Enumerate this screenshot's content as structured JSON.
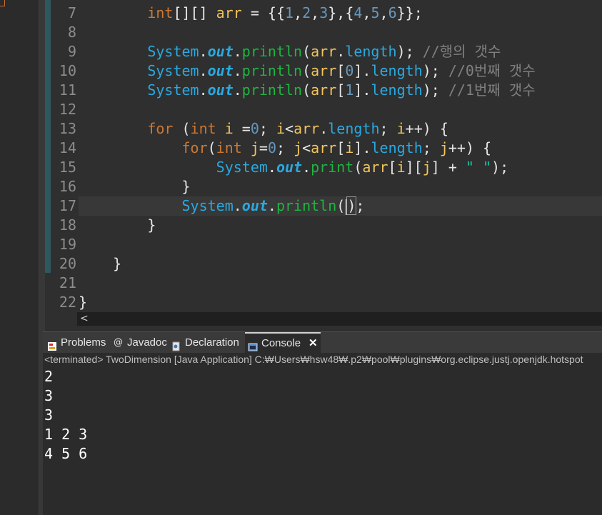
{
  "editor": {
    "line_numbers": [
      "7",
      "8",
      "9",
      "10",
      "11",
      "12",
      "13",
      "14",
      "15",
      "16",
      "17",
      "18",
      "19",
      "20",
      "21",
      "22"
    ],
    "scroll_left_arrow": "<"
  },
  "code": {
    "l7": {
      "indent": "        ",
      "t1": "int",
      "t2": "[][] ",
      "v1": "arr",
      "t3": " = {{",
      "n1": "1",
      "c1": ",",
      "n2": "2",
      "c2": ",",
      "n3": "3",
      "t4": "},{",
      "n4": "4",
      "c3": ",",
      "n5": "5",
      "c4": ",",
      "n6": "6",
      "t5": "}};"
    },
    "l9": {
      "indent": "        ",
      "cls": "System",
      "dot1": ".",
      "fld": "out",
      "dot2": ".",
      "mth": "println",
      "p1": "(",
      "var": "arr",
      "dot3": ".",
      "prop": "length",
      "p2": "); ",
      "cmt": "//행의 갯수"
    },
    "l10": {
      "indent": "        ",
      "cls": "System",
      "dot1": ".",
      "fld": "out",
      "dot2": ".",
      "mth": "println",
      "p1": "(",
      "var": "arr",
      "b1": "[",
      "n": "0",
      "b2": "]",
      "dot3": ".",
      "prop": "length",
      "p2": "); ",
      "cmt": "//0번째 갯수"
    },
    "l11": {
      "indent": "        ",
      "cls": "System",
      "dot1": ".",
      "fld": "out",
      "dot2": ".",
      "mth": "println",
      "p1": "(",
      "var": "arr",
      "b1": "[",
      "n": "1",
      "b2": "]",
      "dot3": ".",
      "prop": "length",
      "p2": "); ",
      "cmt": "//1번째 갯수"
    },
    "l13": {
      "indent": "        ",
      "kw": "for",
      "p1": " (",
      "type": "int",
      "sp": " ",
      "v1": "i",
      "eq": " =",
      "n": "0",
      "s1": "; ",
      "v2": "i",
      "lt": "<",
      "v3": "arr",
      "dot": ".",
      "prop": "length",
      "s2": "; ",
      "v4": "i",
      "inc": "++) {"
    },
    "l14": {
      "indent": "            ",
      "kw": "for",
      "p1": "(",
      "type": "int",
      "sp": " ",
      "v1": "j",
      "eq": "=",
      "n": "0",
      "s1": "; ",
      "v2": "j",
      "lt": "<",
      "v3": "arr",
      "b1": "[",
      "v4": "i",
      "b2": "]",
      "dot": ".",
      "prop": "length",
      "s2": "; ",
      "v5": "j",
      "inc": "++) {"
    },
    "l15": {
      "indent": "                ",
      "cls": "System",
      "dot1": ".",
      "fld": "out",
      "dot2": ".",
      "mth": "print",
      "p1": "(",
      "v1": "arr",
      "b1": "[",
      "v2": "i",
      "b2": "][",
      "v3": "j",
      "b3": "] + ",
      "str": "\" \"",
      "p2": ");"
    },
    "l16": {
      "indent": "            ",
      "brace": "}"
    },
    "l17": {
      "indent": "            ",
      "cls": "System",
      "dot1": ".",
      "fld": "out",
      "dot2": ".",
      "mth": "println",
      "p1": "(",
      "p2": ")",
      "p3": ";"
    },
    "l18": {
      "indent": "        ",
      "brace": "}"
    },
    "l20": {
      "indent": "    ",
      "brace": "}"
    },
    "l22": {
      "brace": "}"
    }
  },
  "tabs": [
    {
      "label": "Problems",
      "icon": "problems-icon"
    },
    {
      "label": "Javadoc",
      "icon": "javadoc-icon"
    },
    {
      "label": "Declaration",
      "icon": "declaration-icon"
    },
    {
      "label": "Console",
      "icon": "console-icon",
      "active": true
    }
  ],
  "console": {
    "header": "<terminated> TwoDimension [Java Application] C:₩Users₩hsw48₩.p2₩pool₩plugins₩org.eclipse.justj.openjdk.hotspot",
    "output": [
      "2",
      "3",
      "3",
      "1 2 3",
      "4 5 6"
    ]
  },
  "colors": {
    "background": "#2f2f2f",
    "keyword": "#cc7832",
    "variable": "#f2c55c",
    "number": "#6897bb",
    "class": "#2aa9e0",
    "method": "#1eb540",
    "comment": "#808080",
    "string": "#17c6a3"
  }
}
